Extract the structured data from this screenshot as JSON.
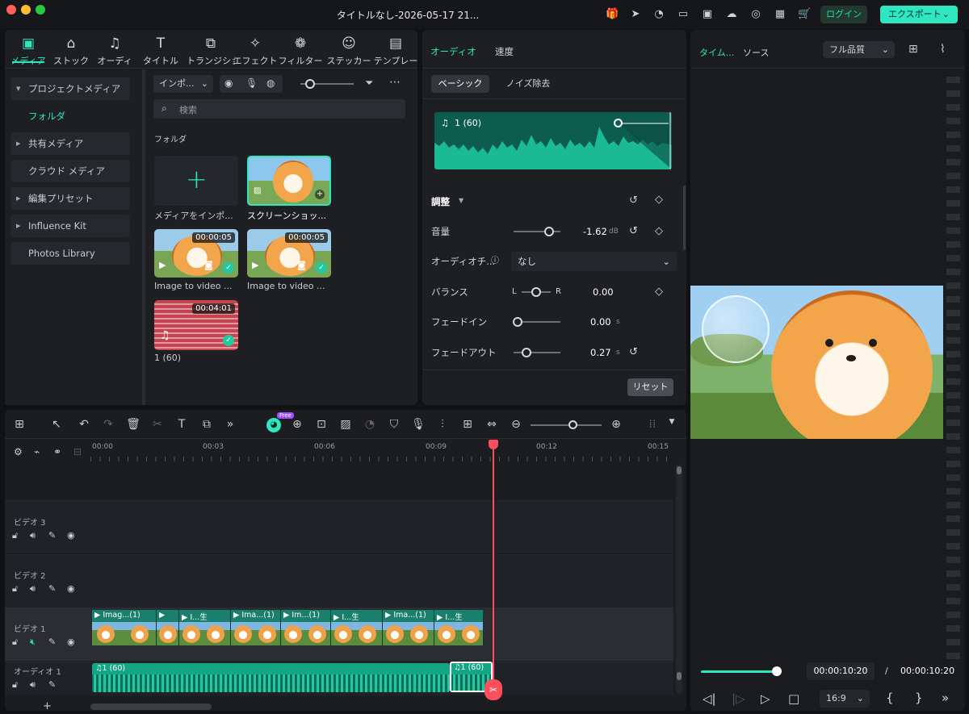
{
  "window": {
    "title": "タイトルなし-2026-05-17 21...",
    "login": "ログイン",
    "export": "エクスポート"
  },
  "media_tabs": [
    {
      "label": "メディア",
      "icon": "media-icon"
    },
    {
      "label": "ストック",
      "icon": "stock-icon"
    },
    {
      "label": "オーディオ",
      "icon": "audio-icon"
    },
    {
      "label": "タイトル",
      "icon": "title-icon"
    },
    {
      "label": "トランジション",
      "icon": "transition-icon"
    },
    {
      "label": "エフェクト",
      "icon": "effect-icon"
    },
    {
      "label": "フィルター",
      "icon": "filter-icon"
    },
    {
      "label": "ステッカー",
      "icon": "sticker-icon"
    },
    {
      "label": "テンプレー",
      "icon": "template-icon"
    }
  ],
  "sidebar": {
    "items": [
      {
        "label": "プロジェクトメディア"
      },
      {
        "label": "フォルダ"
      },
      {
        "label": "共有メディア"
      },
      {
        "label": "クラウド メディア"
      },
      {
        "label": "編集プリセット"
      },
      {
        "label": "Influence Kit"
      },
      {
        "label": "Photos Library"
      }
    ]
  },
  "media": {
    "import_label": "インポ...",
    "search_placeholder": "検索",
    "folder_heading": "フォルダ",
    "items": [
      {
        "label": "メディアをインポ..."
      },
      {
        "label": "スクリーンショッ..."
      },
      {
        "label": "Image to video ...",
        "duration": "00:00:05"
      },
      {
        "label": "Image to video ...",
        "duration": "00:00:05"
      },
      {
        "label": "1 (60)",
        "duration": "00:04:01"
      }
    ]
  },
  "props": {
    "tabs": [
      "オーディオ",
      "速度"
    ],
    "subtabs": [
      "ベーシック",
      "ノイズ除去"
    ],
    "clip_name": "1 (60)",
    "adjust": "調整",
    "volume_label": "音量",
    "volume_value": "-1.62",
    "volume_unit": "dB",
    "ducking_label": "オーディオチ...",
    "ducking_value": "なし",
    "balance_label": "バランス",
    "balance_l": "L",
    "balance_r": "R",
    "balance_value": "0.00",
    "fadein_label": "フェードイン",
    "fadein_value": "0.00",
    "fadein_unit": "s",
    "fadeout_label": "フェードアウト",
    "fadeout_value": "0.27",
    "fadeout_unit": "s",
    "reset": "リセット"
  },
  "timeline": {
    "ruler": [
      "00:00",
      "00:03",
      "00:06",
      "00:09",
      "00:12",
      "00:15"
    ],
    "tracks": [
      "ビデオ 3",
      "ビデオ 2",
      "ビデオ 1",
      "オーディオ 1"
    ],
    "video_clips": [
      "Imag...(1)",
      "",
      "",
      "I...生",
      "Ima...(1)",
      "Im...(1)",
      "I...生",
      "Ima...(1)",
      "I...生"
    ],
    "audio_clips": [
      "1 (60)",
      "1 (60)"
    ],
    "free_badge": "Free"
  },
  "preview": {
    "tabs": [
      "タイム...",
      "ソース"
    ],
    "quality": "フル品質",
    "current_time": "00:00:10:20",
    "separator": "/",
    "total_time": "00:00:10:20",
    "ratio": "16:9",
    "progress": 1.0
  }
}
